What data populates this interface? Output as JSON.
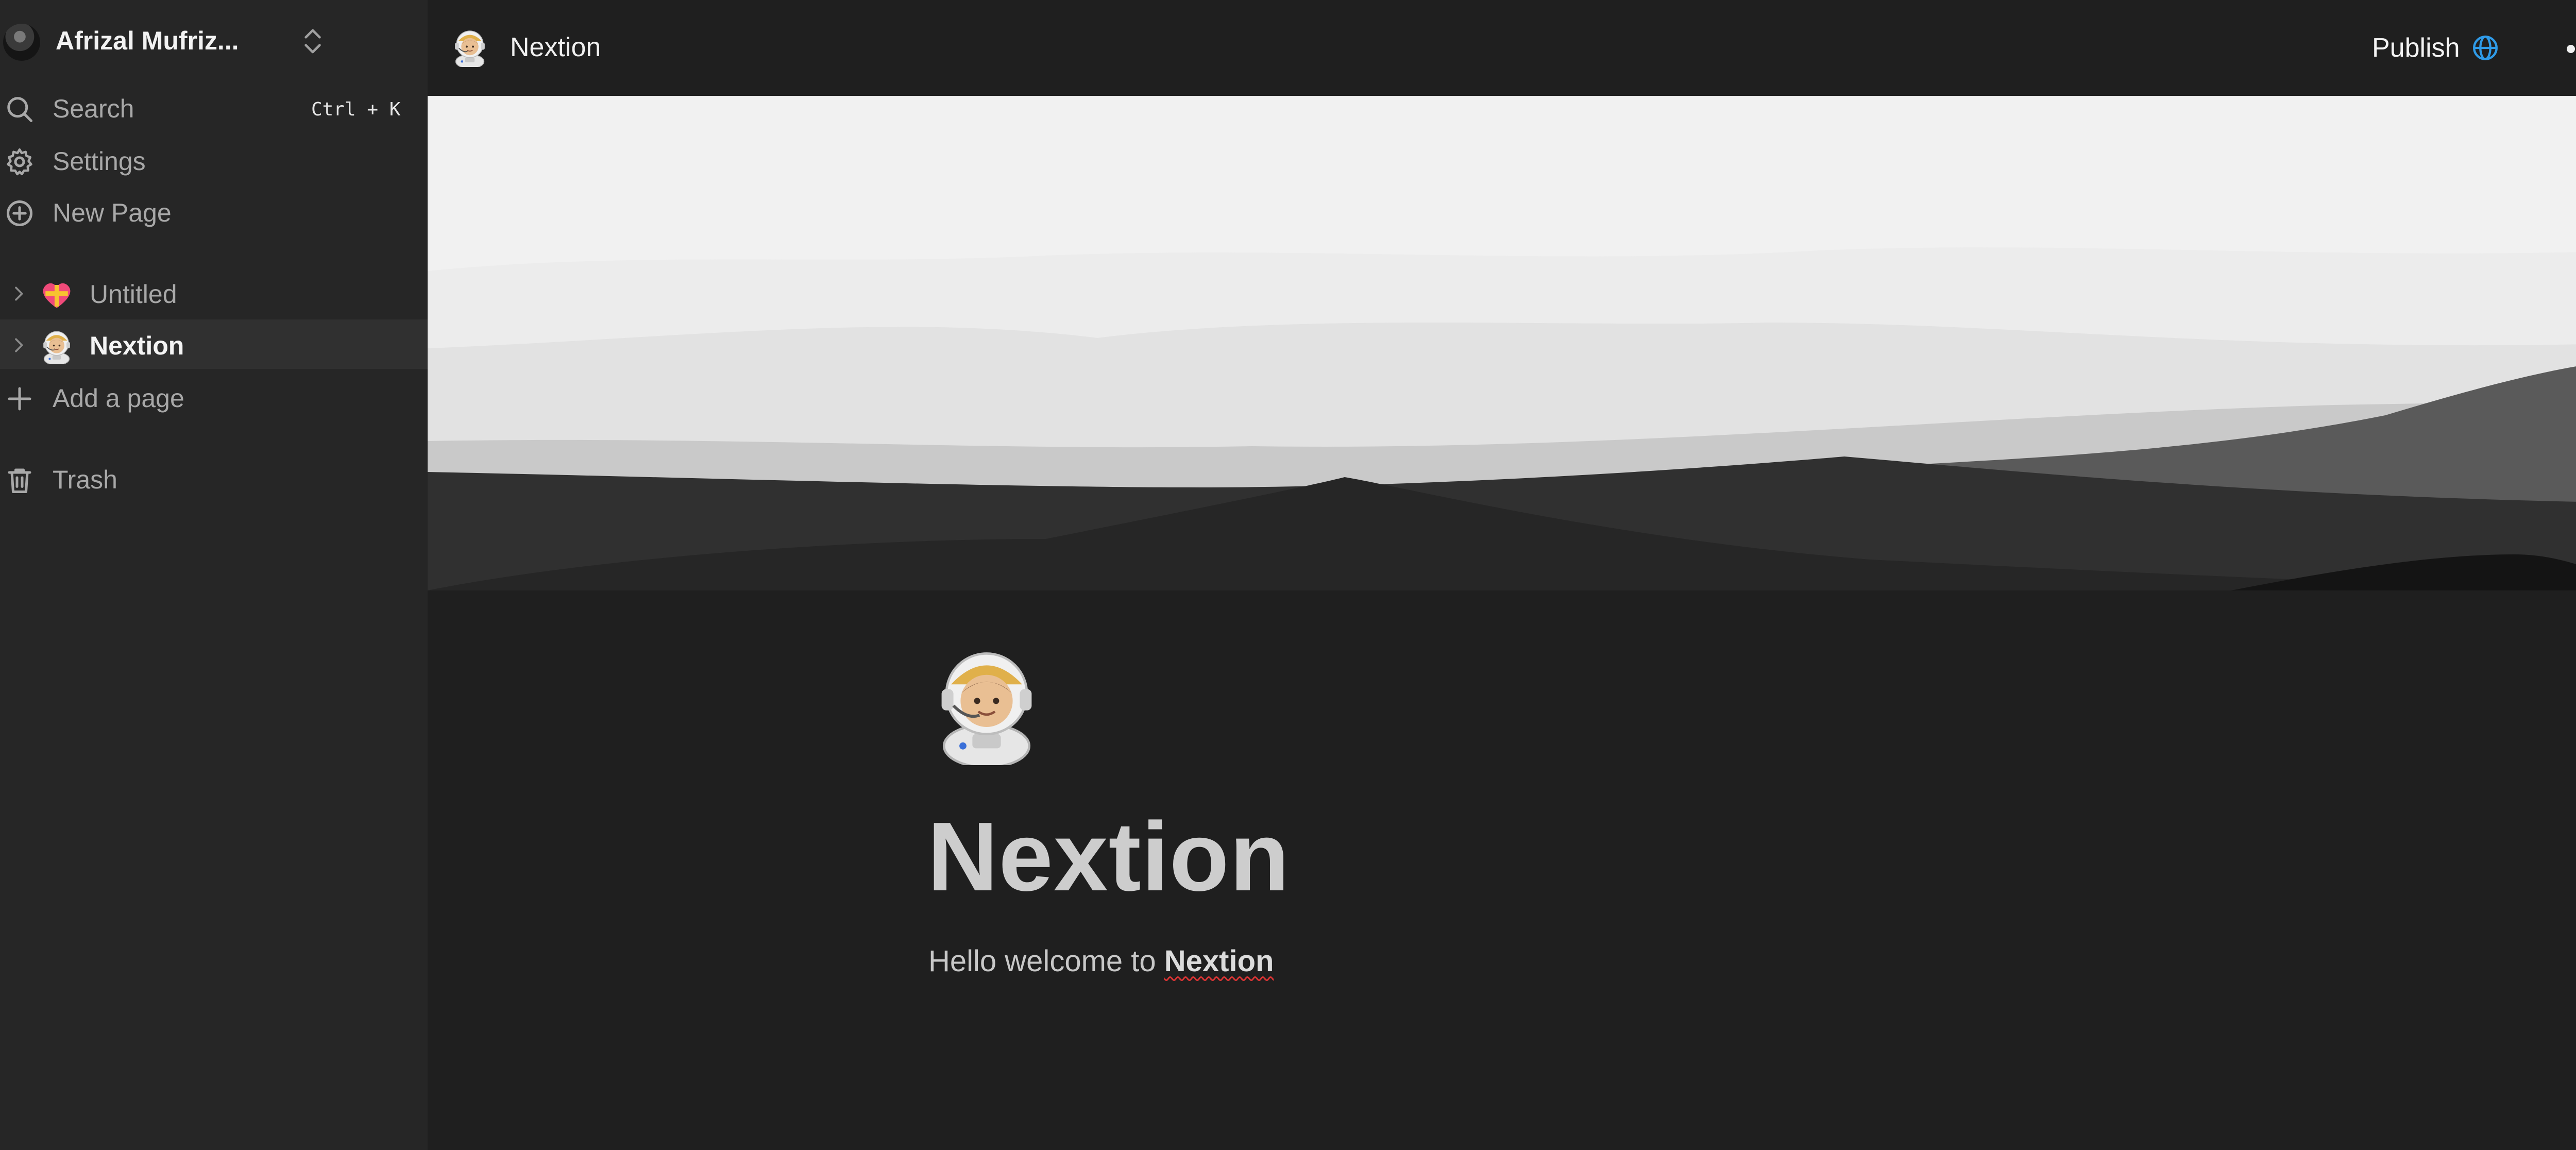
{
  "workspace": {
    "name": "Afrizal Mufriz..."
  },
  "sidebar": {
    "search": {
      "label": "Search",
      "shortcut": "Ctrl + K"
    },
    "settings": {
      "label": "Settings"
    },
    "new_page": {
      "label": "New Page"
    },
    "pages": [
      {
        "label": "Untitled",
        "emoji": "heart-emoji"
      },
      {
        "label": "Nextion",
        "emoji": "astronaut-emoji",
        "active": true
      }
    ],
    "add_page": {
      "label": "Add a page"
    },
    "trash": {
      "label": "Trash"
    }
  },
  "topbar": {
    "title": "Nextion",
    "publish_label": "Publish",
    "accent": "#2f9be8"
  },
  "document": {
    "title": "Nextion",
    "intro_text": "Hello welcome to ",
    "intro_bold": "Nextion"
  },
  "icons": {
    "search": "search-icon",
    "settings": "gear-icon",
    "new_page": "plus-circle-icon",
    "add_page": "plus-icon",
    "trash": "trash-icon",
    "publish": "globe-icon",
    "more": "more-horizontal-icon"
  }
}
